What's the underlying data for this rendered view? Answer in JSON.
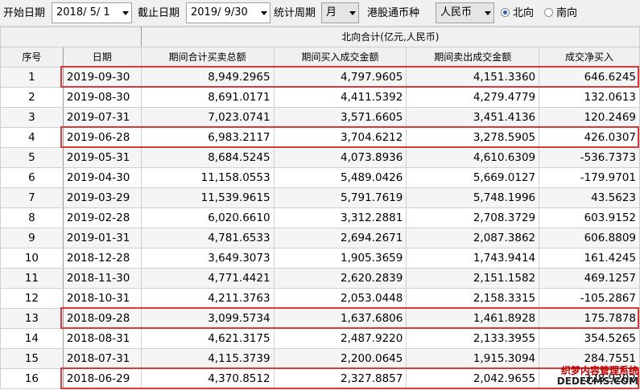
{
  "filters": {
    "start_label": "开始日期",
    "start_value": "2018/  5/  1",
    "end_label": "截止日期",
    "end_value": "2019/  9/30",
    "period_label": "统计周期",
    "period_value": "月",
    "currency_label": "港股通币种",
    "currency_value": "人民币",
    "direction_north": "北向",
    "direction_south": "南向"
  },
  "table": {
    "group_header": "北向合计(亿元,人民币)",
    "columns": [
      "序号",
      "日期",
      "期间合计买卖总额",
      "期间买入成交金额",
      "期间卖出成交金额",
      "成交净买入"
    ],
    "rows": [
      [
        "1",
        "2019-09-30",
        "8,949.2965",
        "4,797.9605",
        "4,151.3360",
        "646.6245"
      ],
      [
        "2",
        "2019-08-30",
        "8,691.0171",
        "4,411.5392",
        "4,279.4779",
        "132.0613"
      ],
      [
        "3",
        "2019-07-31",
        "7,023.0741",
        "3,571.6605",
        "3,451.4136",
        "120.2469"
      ],
      [
        "4",
        "2019-06-28",
        "6,983.2117",
        "3,704.6212",
        "3,278.5905",
        "426.0307"
      ],
      [
        "5",
        "2019-05-31",
        "8,684.5245",
        "4,073.8936",
        "4,610.6309",
        "-536.7373"
      ],
      [
        "6",
        "2019-04-30",
        "11,158.0553",
        "5,489.0426",
        "5,669.0127",
        "-179.9701"
      ],
      [
        "7",
        "2019-03-29",
        "11,539.9615",
        "5,791.7619",
        "5,748.1996",
        "43.5623"
      ],
      [
        "8",
        "2019-02-28",
        "6,020.6610",
        "3,312.2881",
        "2,708.3729",
        "603.9152"
      ],
      [
        "9",
        "2019-01-31",
        "4,781.6533",
        "2,694.2671",
        "2,087.3862",
        "606.8809"
      ],
      [
        "10",
        "2018-12-28",
        "3,649.3073",
        "1,905.3659",
        "1,743.9414",
        "161.4245"
      ],
      [
        "11",
        "2018-11-30",
        "4,771.4421",
        "2,620.2839",
        "2,151.1582",
        "469.1257"
      ],
      [
        "12",
        "2018-10-31",
        "4,211.3763",
        "2,053.0448",
        "2,158.3315",
        "-105.2867"
      ],
      [
        "13",
        "2018-09-28",
        "3,099.5734",
        "1,637.6806",
        "1,461.8928",
        "175.7878"
      ],
      [
        "14",
        "2018-08-31",
        "4,621.3175",
        "2,487.9220",
        "2,133.3955",
        "354.5265"
      ],
      [
        "15",
        "2018-07-31",
        "4,115.3739",
        "2,200.0645",
        "1,915.3094",
        "284.7551"
      ],
      [
        "16",
        "2018-06-29",
        "4,370.8512",
        "2,327.8857",
        "2,042.9655",
        "328.9202"
      ]
    ]
  },
  "highlighted_rows": [
    "1",
    "4",
    "13",
    "16"
  ],
  "watermark": {
    "line1": "织梦内容管理系统",
    "line2": "DEDECMS.COM"
  },
  "colors": {
    "highlight_border": "#d83a3a",
    "header_bg": "#f0f0f0",
    "row_alt_bg": "#f5f5f5",
    "radio_selected": "#1f5fbf"
  }
}
